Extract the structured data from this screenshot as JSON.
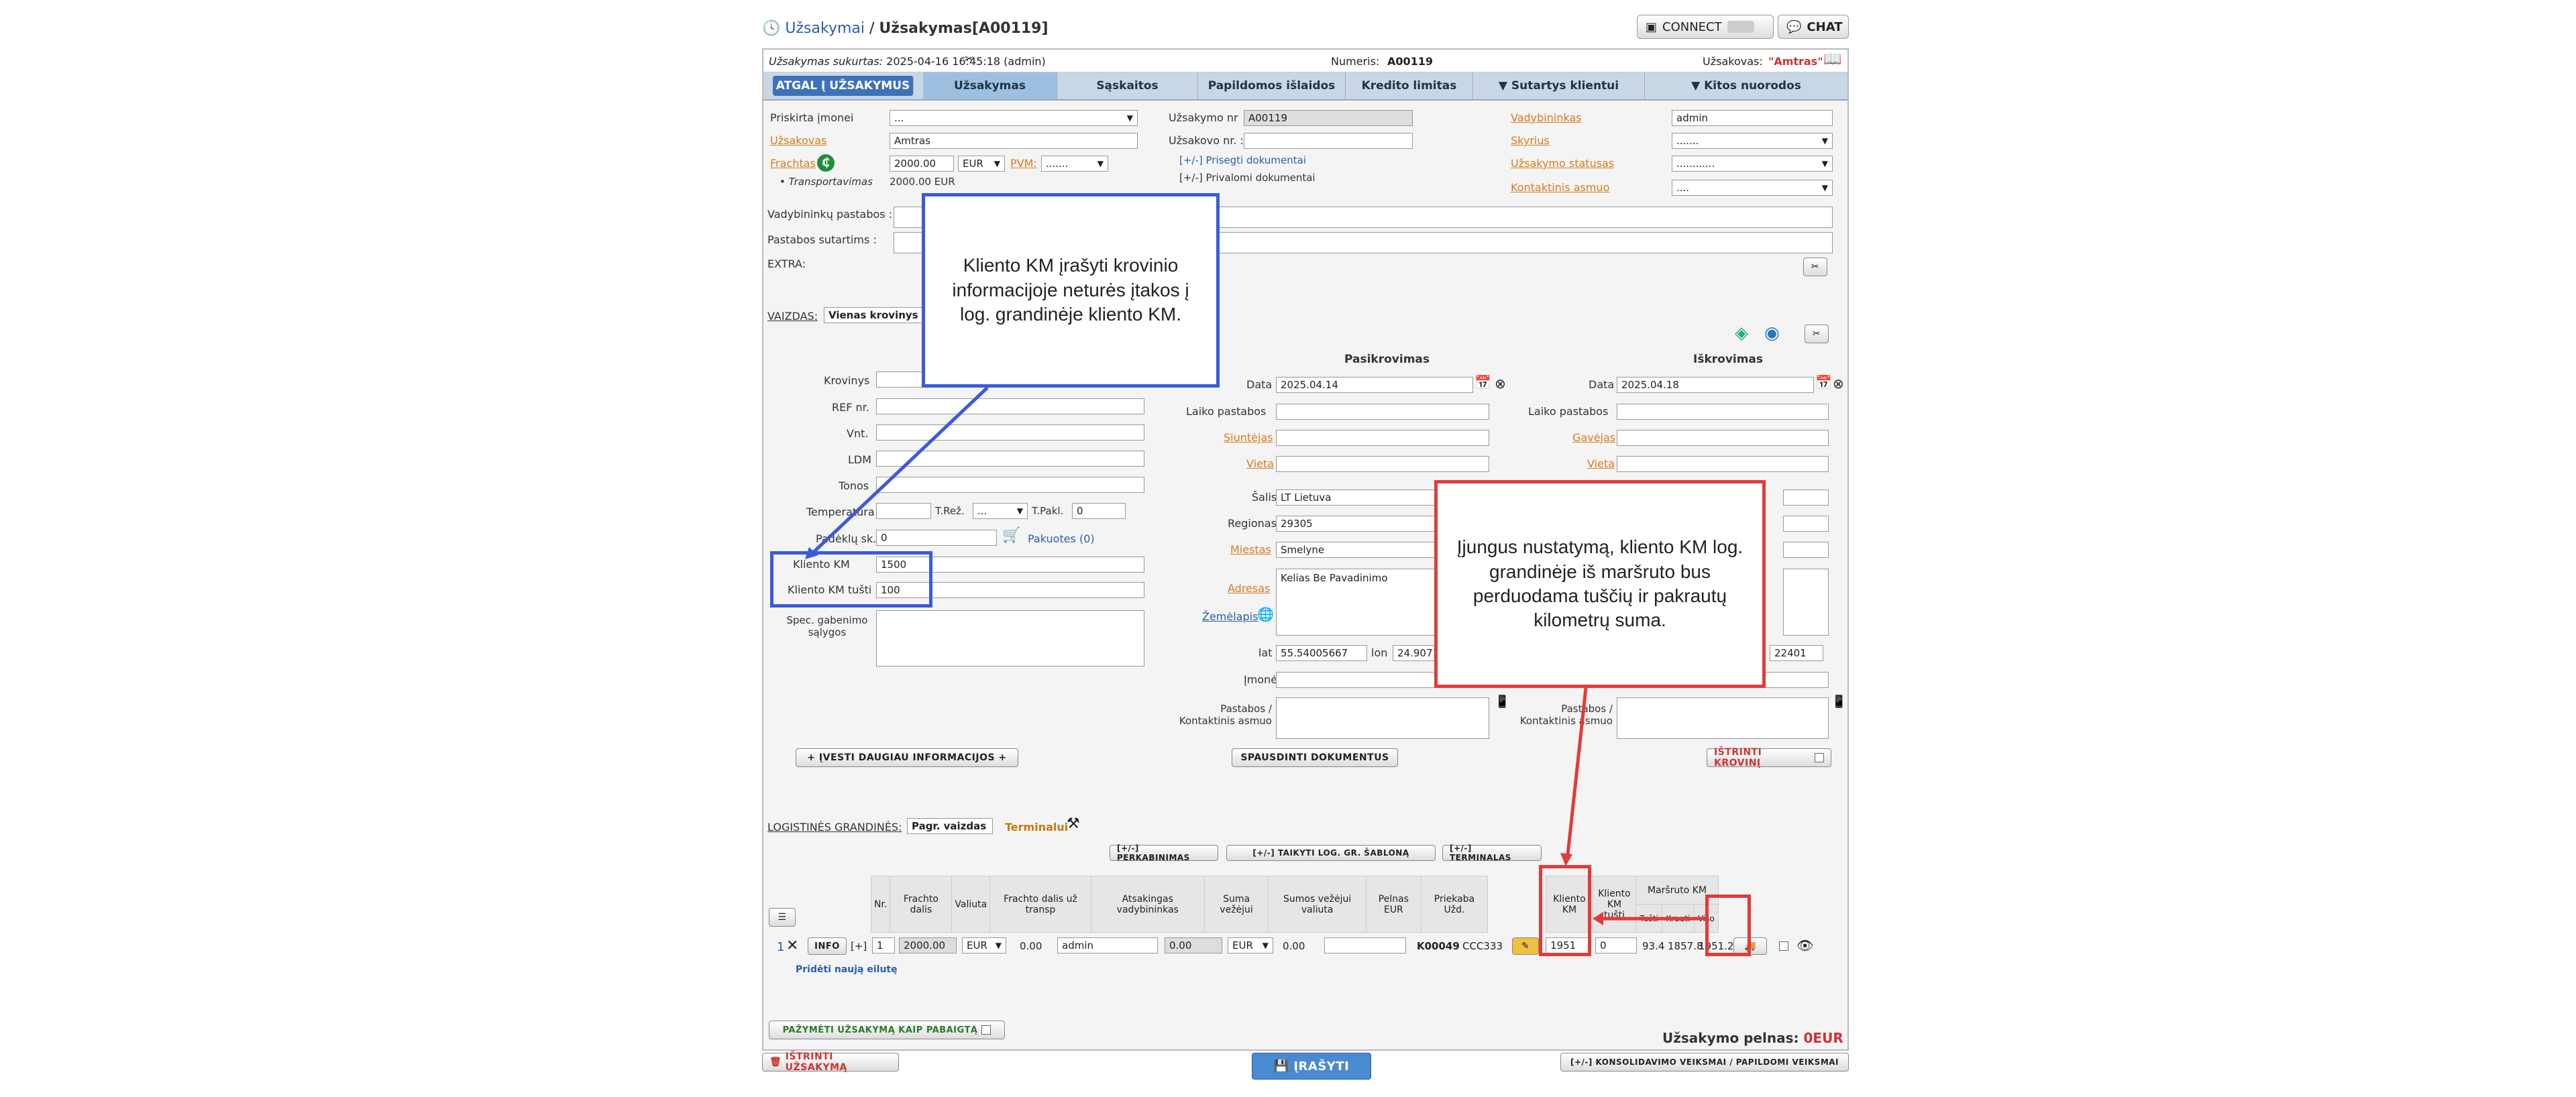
{
  "breadcrumb": {
    "root": "Užsakymai",
    "separator": "/",
    "current": "Užsakymas[A00119]"
  },
  "top": {
    "connect": "CONNECT",
    "chat": "CHAT"
  },
  "info": {
    "created_label": "Užsakymas sukurtas:",
    "created_value": "2025-04-16 16:45:18 (admin)",
    "number_label": "Numeris:",
    "number_value": "A00119",
    "customer_label": "Užsakovas:",
    "customer_value": "\"Amtras\""
  },
  "tabs": {
    "back": "ATGAL Į UŽSAKYMUS",
    "order": "Užsakymas",
    "invoices": "Sąskaitos",
    "extra": "Papildomos išlaidos",
    "credit": "Kredito limitas",
    "contract": "▼ Sutartys klientui",
    "other": "▼ Kitos nuorodos"
  },
  "form": {
    "company_label": "Priskirta įmonei",
    "company_value": "...",
    "customer_label": "Užsakovas",
    "customer_value": "Amtras",
    "freight_label": "Frachtas",
    "freight_value": "2000.00",
    "currency": "EUR",
    "vat_label": "PVM:",
    "vat_value": ".......",
    "transport_label": "Transportavimas",
    "transport_value": "2000.00 EUR",
    "order_no_label": "Užsakymo nr",
    "order_no_value": "A00119",
    "cust_order_label": "Užsakovo nr. :",
    "attached_docs": "[+/-] Prisegti dokumentai",
    "private_docs": "[+/-] Privalomi dokumentai",
    "manager_label": "Vadybininkas",
    "manager_value": "admin",
    "dept_label": "Skyrius",
    "dept_value": ".......",
    "status_label": "Užsakymo statusas",
    "status_value": "............",
    "contact_label": "Kontaktinis asmuo",
    "contact_value": "....",
    "manager_notes": "Vadybininkų pastabos :",
    "contract_notes": "Pastabos sutartims :",
    "extra": "EXTRA:"
  },
  "view": {
    "label": "VAIZDAS:",
    "value": "Vienas krovinys"
  },
  "cargo": {
    "cargo": "Krovinys",
    "ref": "REF nr.",
    "units": "Vnt.",
    "ldm": "LDM",
    "tons": "Tonos",
    "temp": "Temperatūra",
    "treg": "T.Rež.",
    "treg_value": "...",
    "tpakl": "T.Pakl.",
    "tpakl_value": "0",
    "pallets": "Padėklų sk.",
    "pallets_value": "0",
    "packed": "Pakuotes (0)",
    "client_km": "Kliento KM",
    "client_km_value": "1500",
    "client_km_empty": "Kliento KM tušti",
    "client_km_empty_value": "100",
    "spec": "Spec. gabenimo sąlygos"
  },
  "loading": {
    "title": "Pasikrovimas",
    "date_label": "Data",
    "date_value": "2025.04.14",
    "time_notes": "Laiko pastabos",
    "sender": "Siuntėjas",
    "place": "Vieta",
    "country_label": "Šalis",
    "country_value": "LT Lietuva",
    "region_label": "Regionas",
    "region_value": "29305",
    "city_label": "Miestas",
    "city_value": "Smelyne",
    "address_label": "Adresas",
    "address_value": "Kelias Be Pavadinimo",
    "map": "Žemėlapis",
    "lat_label": "lat",
    "lat_value": "55.54005667",
    "lon_label": "lon",
    "lon_value": "24.9071",
    "company": "Įmonė",
    "notes": "Pastabos / Kontaktinis asmuo"
  },
  "unloading": {
    "title": "Iškrovimas",
    "date_label": "Data",
    "date_value": "2025.04.18",
    "time_notes": "Laiko pastabos",
    "receiver": "Gavėjas",
    "place": "Vieta",
    "lon_value": "22401",
    "notes": "Pastabos / Kontaktinis asmuo"
  },
  "actions": {
    "more_info": "+ ĮVESTI DAUGIAU INFORMACIJOS +",
    "print": "SPAUSDINTI DOKUMENTUS",
    "delete_cargo": "IŠTRINTI KROVINĮ"
  },
  "chain": {
    "label": "LOGISTINĖS GRANDINĖS:",
    "view": "Pagr. vaizdas",
    "terminals": "Terminalui",
    "reloads": "[+/-] PERKABINIMAS",
    "template": "[+/-] TAIKYTI LOG. GR. ŠABLONĄ",
    "terminals_btn": "[+/-] TERMINALAS",
    "headers": [
      "Nr.",
      "Frachto dalis",
      "Valiuta",
      "Frachto dalis už transp",
      "Atsakingas vadybininkas",
      "Suma vežėjui",
      "Sumos vežėjui valiuta",
      "Pelnas EUR",
      "Priekaba Užd."
    ],
    "h_client_km": "Kliento KM",
    "h_client_km_empty": "Kliento KM tušti",
    "h_route": "Maršruto KM",
    "h_empty": "Tušti",
    "h_loaded": "Krauti",
    "h_total": "Viso",
    "row": {
      "idx": "1",
      "info": "INFO",
      "plus": "[+]",
      "nr": "1",
      "freight": "2000.00",
      "cur": "EUR",
      "freight_t": "0.00",
      "manager": "admin",
      "carrier_sum": "0.00",
      "carrier_cur": "EUR",
      "profit": "0.00",
      "carrier": "K00049",
      "plate": "CCC333",
      "client_km": "1951",
      "client_km_empty": "0",
      "empty": "93.4",
      "loaded": "1857.8",
      "total": "1951.2"
    },
    "add_row": "Pridėti naują eilutę"
  },
  "bottom": {
    "mark_done": "PAŽYMĖTI UŽSAKYMĄ KAIP PABAIGTĄ",
    "profit_label": "Užsakymo pelnas:",
    "profit_value": "0EUR",
    "delete_order": "IŠTRINTI UŽSAKYMĄ",
    "save": "ĮRAŠYTI",
    "consolidation": "[+/-] KONSOLIDAVIMO VEIKSMAI / PAPILDOMI VEIKSMAI"
  },
  "callouts": {
    "blue": "Kliento KM įrašyti krovinio informacijoje neturės įtakos į log. grandinėje kliento KM.",
    "red": "Įjungus nustatymą, kliento KM log. grandinėje iš maršruto bus perduodama tuščių ir pakrautų kilometrų suma."
  },
  "colors": {
    "blue": "#3b5bdb",
    "red": "#e23b3b",
    "tab": "#3e72b8"
  }
}
